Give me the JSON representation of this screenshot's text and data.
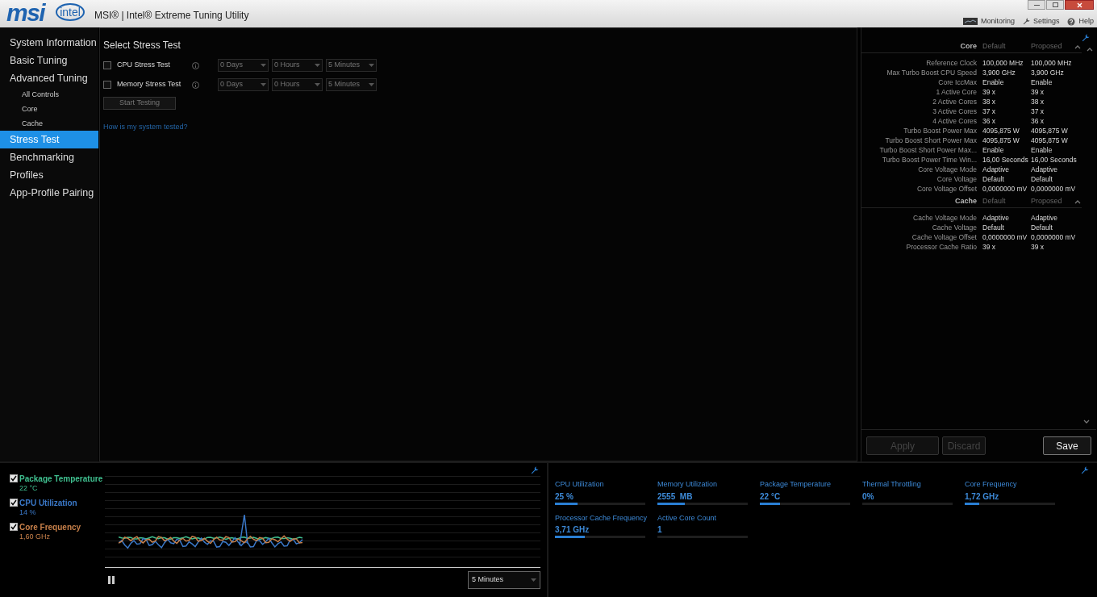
{
  "window": {
    "title": "MSI® | Intel® Extreme Tuning Utility",
    "logo_left": "msi",
    "logo_right": "intel"
  },
  "toolbar": [
    {
      "kind": "monitoring",
      "label": "Monitoring"
    },
    {
      "kind": "settings",
      "label": "Settings"
    },
    {
      "kind": "help",
      "label": "Help"
    }
  ],
  "sidebar": {
    "items": [
      {
        "label": "System Information",
        "selected": false
      },
      {
        "label": "Basic Tuning",
        "selected": false
      },
      {
        "label": "Advanced Tuning",
        "selected": false,
        "children": [
          {
            "label": "All Controls",
            "selected": false
          },
          {
            "label": "Core",
            "selected": false
          },
          {
            "label": "Cache",
            "selected": false
          }
        ]
      },
      {
        "label": "Stress Test",
        "selected": true
      },
      {
        "label": "Benchmarking",
        "selected": false
      },
      {
        "label": "Profiles",
        "selected": false
      },
      {
        "label": "App-Profile Pairing",
        "selected": false
      }
    ]
  },
  "stress_test": {
    "title": "Select Stress Test",
    "tests": [
      {
        "label": "CPU Stress Test",
        "checked": false,
        "duration": [
          "0 Days",
          "0 Hours",
          "5 Minutes"
        ]
      },
      {
        "label": "Memory Stress Test",
        "checked": false,
        "duration": [
          "0 Days",
          "0 Hours",
          "5 Minutes"
        ]
      }
    ],
    "start_button": {
      "label": "Start Testing",
      "disabled": true
    },
    "link": "How is my system tested?"
  },
  "settings_panel": {
    "sections": [
      {
        "title": "Core",
        "default_heading": "Default",
        "proposed_heading": "Proposed",
        "expanded": true,
        "rows": [
          {
            "label": "Reference Clock",
            "default": "100,000 MHz",
            "proposed": "100,000 MHz"
          },
          {
            "label": "Max Turbo Boost CPU Speed",
            "default": "3,900 GHz",
            "proposed": "3,900 GHz"
          },
          {
            "label": "Core IccMax",
            "default": "Enable",
            "proposed": "Enable"
          },
          {
            "label": "1 Active Core",
            "default": "39 x",
            "proposed": "39 x"
          },
          {
            "label": "2 Active Cores",
            "default": "38 x",
            "proposed": "38 x"
          },
          {
            "label": "3 Active Cores",
            "default": "37 x",
            "proposed": "37 x"
          },
          {
            "label": "4 Active Cores",
            "default": "36 x",
            "proposed": "36 x"
          },
          {
            "label": "Turbo Boost Power Max",
            "default": "4095,875 W",
            "proposed": "4095,875 W"
          },
          {
            "label": "Turbo Boost Short Power Max",
            "default": "4095,875 W",
            "proposed": "4095,875 W"
          },
          {
            "label": "Turbo Boost Short Power Max...",
            "default": "Enable",
            "proposed": "Enable"
          },
          {
            "label": "Turbo Boost Power Time Win...",
            "default": "16,00 Seconds",
            "proposed": "16,00 Seconds"
          },
          {
            "label": "Core Voltage Mode",
            "default": "Adaptive",
            "proposed": "Adaptive"
          },
          {
            "label": "Core Voltage",
            "default": "Default",
            "proposed": "Default"
          },
          {
            "label": "Core Voltage Offset",
            "default": "0,0000000 mV",
            "proposed": "0,0000000 mV"
          }
        ]
      },
      {
        "title": "Cache",
        "default_heading": "Default",
        "proposed_heading": "Proposed",
        "expanded": true,
        "rows": [
          {
            "label": "Cache Voltage Mode",
            "default": "Adaptive",
            "proposed": "Adaptive"
          },
          {
            "label": "Cache Voltage",
            "default": "Default",
            "proposed": "Default"
          },
          {
            "label": "Cache Voltage Offset",
            "default": "0,0000000 mV",
            "proposed": "0,0000000 mV"
          },
          {
            "label": "Processor Cache Ratio",
            "default": "39 x",
            "proposed": "39 x"
          }
        ]
      }
    ],
    "buttons": [
      {
        "label": "Apply",
        "disabled": true
      },
      {
        "label": "Discard",
        "disabled": true
      },
      {
        "label": "Save",
        "disabled": false
      }
    ]
  },
  "monitor": {
    "legend": [
      {
        "label": "Package Temperature",
        "value": "22 °C",
        "checked": true,
        "color": "#3fbf8f"
      },
      {
        "label": "CPU Utilization",
        "value": "14 %",
        "checked": true,
        "color": "#3a78c8"
      },
      {
        "label": "Core Frequency",
        "value": "1,60 GHz",
        "checked": true,
        "color": "#c8804a"
      }
    ],
    "range": "5 Minutes"
  },
  "metrics": [
    {
      "label": "CPU Utilization",
      "value": "25 %",
      "level": 0.25
    },
    {
      "label": "Memory Utilization",
      "value": "2555  MB",
      "level": 0.3
    },
    {
      "label": "Package Temperature",
      "value": "22 °C",
      "level": 0.22
    },
    {
      "label": "Thermal Throttling",
      "value": "0%"
    },
    {
      "label": "Core Frequency",
      "value": "1,72 GHz",
      "level": 0.16
    },
    {
      "label": "Processor Cache Frequency",
      "value": "3,71 GHz",
      "level": 0.33
    },
    {
      "label": "Active Core Count",
      "value": "1"
    }
  ]
}
